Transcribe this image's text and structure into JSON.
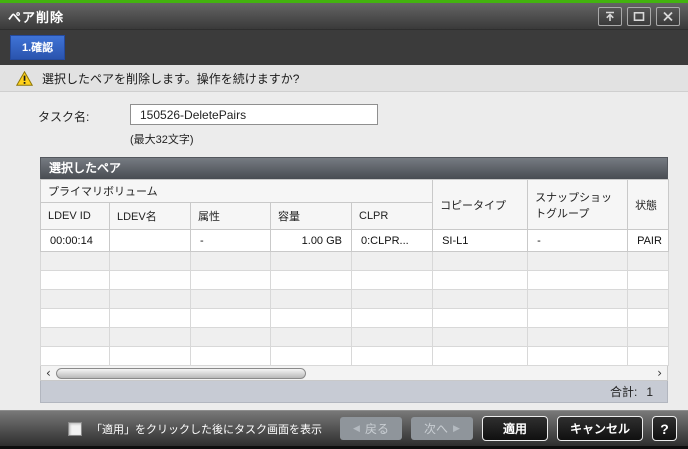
{
  "window": {
    "title": "ペア削除"
  },
  "tab": {
    "label": "1.確認"
  },
  "warning": {
    "message": "選択したペアを削除します。操作を続けますか?"
  },
  "task": {
    "label": "タスク名:",
    "value": "150526-DeletePairs",
    "hint": "(最大32文字)"
  },
  "table": {
    "title": "選択したペア",
    "group_header": "プライマリボリューム",
    "columns": [
      "LDEV ID",
      "LDEV名",
      "属性",
      "容量",
      "CLPR",
      "コピータイプ",
      "スナップショットグループ",
      "状態"
    ],
    "rows": [
      [
        "00:00:14",
        "",
        "-",
        "1.00 GB",
        "0:CLPR...",
        "SI-L1",
        "-",
        "PAIR"
      ]
    ],
    "total_label": "合計:",
    "total_value": "1"
  },
  "footer": {
    "checkbox_label": "「適用」をクリックした後にタスク画面を表示",
    "back_label": "戻る",
    "next_label": "次へ",
    "apply_label": "適用",
    "cancel_label": "キャンセル",
    "help_label": "?"
  },
  "icons": {
    "back_arrow": "◀",
    "next_arrow": "▶",
    "scroll_left": "‹",
    "scroll_right": "›"
  },
  "colors": {
    "accent_green": "#43b30f",
    "tab_blue": "#2f5fc4",
    "titlebar_dark": "#3a3a3a",
    "warning_yellow": "#ffd21c",
    "table_header_dark": "#4a4e54",
    "total_bar": "#c7cbd4"
  }
}
